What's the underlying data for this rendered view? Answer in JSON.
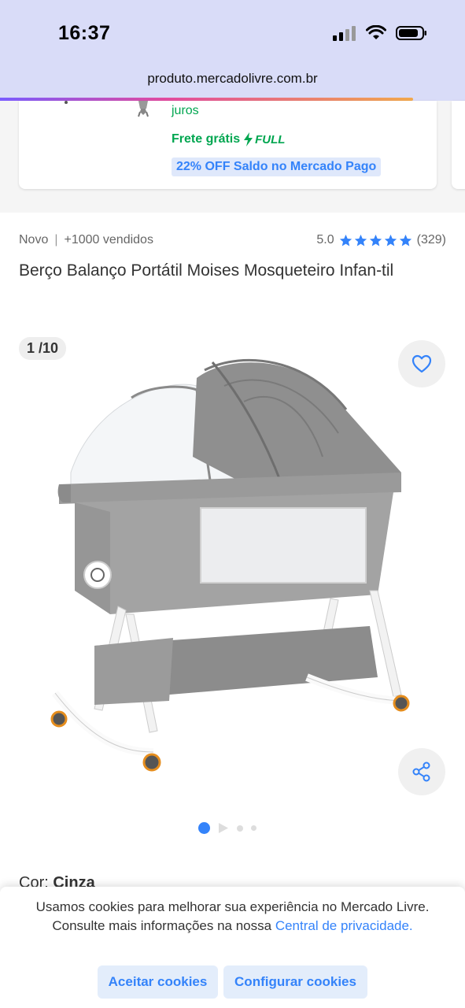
{
  "status_bar": {
    "time": "16:37"
  },
  "browser": {
    "url": "produto.mercadolivre.com.br"
  },
  "related_card": {
    "installment_text": "juros",
    "shipping_text": "Frete grátis",
    "full_label": "FULL",
    "discount_tag": "22% OFF Saldo no Mercado Pago"
  },
  "product": {
    "condition": "Novo",
    "sold": "+1000 vendidos",
    "rating": "5.0",
    "reviews": "(329)",
    "title": "Berço Balanço Portátil Moises Mosqueteiro Infan-til"
  },
  "gallery": {
    "counter": "1 /10",
    "current_index": 1,
    "dots_visible": 4
  },
  "variant": {
    "label": "Cor:",
    "value": "Cinza"
  },
  "cookie_banner": {
    "text": "Usamos cookies para melhorar sua experiência no Mercado Livre. Consulte mais informações na nossa ",
    "link": "Central de privacidade.",
    "accept_label": "Aceitar cookies",
    "config_label": "Configurar cookies"
  },
  "colors": {
    "accent": "#3483fa",
    "green": "#00a650",
    "chrome": "#d9dcf8"
  }
}
